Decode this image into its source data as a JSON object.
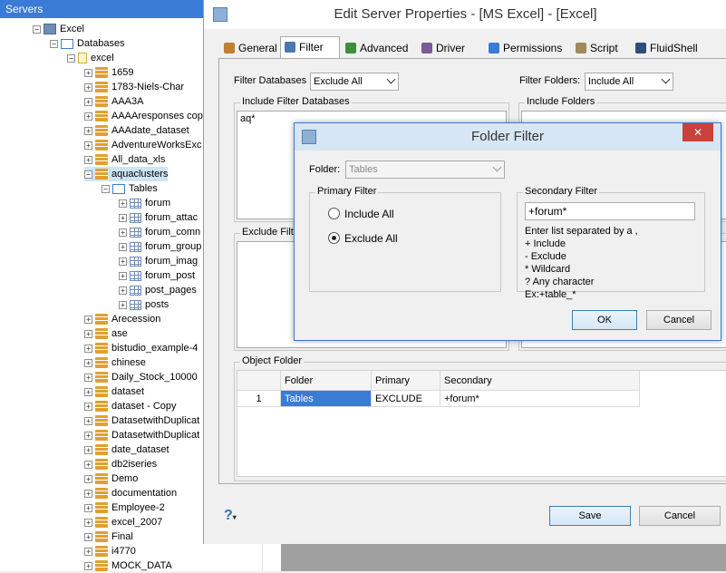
{
  "tree": {
    "header": "Servers",
    "nodes": [
      {
        "label": "Excel",
        "level": 1,
        "icon": "server"
      },
      {
        "label": "Databases",
        "level": 2,
        "icon": "folder"
      },
      {
        "label": "excel",
        "level": 3,
        "icon": "dbfile"
      },
      {
        "label": "1659",
        "level": 4,
        "icon": "db"
      },
      {
        "label": "1783-Niels-Char",
        "level": 4,
        "icon": "db"
      },
      {
        "label": "AAA3A",
        "level": 4,
        "icon": "db"
      },
      {
        "label": "AAAAresponses cop",
        "level": 4,
        "icon": "db"
      },
      {
        "label": "AAAdate_dataset",
        "level": 4,
        "icon": "db"
      },
      {
        "label": "AdventureWorksExc",
        "level": 4,
        "icon": "db"
      },
      {
        "label": "All_data_xls",
        "level": 4,
        "icon": "db"
      },
      {
        "label": "aquaclusters",
        "level": 4,
        "icon": "db",
        "selected": true
      },
      {
        "label": "Tables",
        "level": 5,
        "icon": "folder"
      },
      {
        "label": "forum",
        "level": 6,
        "icon": "table"
      },
      {
        "label": "forum_attac",
        "level": 6,
        "icon": "table"
      },
      {
        "label": "forum_comn",
        "level": 6,
        "icon": "table"
      },
      {
        "label": "forum_group",
        "level": 6,
        "icon": "table"
      },
      {
        "label": "forum_imag",
        "level": 6,
        "icon": "table"
      },
      {
        "label": "forum_post",
        "level": 6,
        "icon": "table"
      },
      {
        "label": "post_pages",
        "level": 6,
        "icon": "table"
      },
      {
        "label": "posts",
        "level": 6,
        "icon": "table"
      },
      {
        "label": "Arecession",
        "level": 4,
        "icon": "db"
      },
      {
        "label": "ase",
        "level": 4,
        "icon": "db"
      },
      {
        "label": "bistudio_example-4",
        "level": 4,
        "icon": "db"
      },
      {
        "label": "chinese",
        "level": 4,
        "icon": "db"
      },
      {
        "label": "Daily_Stock_10000",
        "level": 4,
        "icon": "db"
      },
      {
        "label": "dataset",
        "level": 4,
        "icon": "db"
      },
      {
        "label": "dataset - Copy",
        "level": 4,
        "icon": "db"
      },
      {
        "label": "DatasetwithDuplicat",
        "level": 4,
        "icon": "db"
      },
      {
        "label": "DatasetwithDuplicat",
        "level": 4,
        "icon": "db"
      },
      {
        "label": "date_dataset",
        "level": 4,
        "icon": "db"
      },
      {
        "label": "db2iseries",
        "level": 4,
        "icon": "db"
      },
      {
        "label": "Demo",
        "level": 4,
        "icon": "db"
      },
      {
        "label": "documentation",
        "level": 4,
        "icon": "db"
      },
      {
        "label": "Employee-2",
        "level": 4,
        "icon": "db"
      },
      {
        "label": "excel_2007",
        "level": 4,
        "icon": "db"
      },
      {
        "label": "Final",
        "level": 4,
        "icon": "db"
      },
      {
        "label": "i4770",
        "level": 4,
        "icon": "db"
      },
      {
        "label": "MOCK_DATA",
        "level": 4,
        "icon": "db"
      }
    ]
  },
  "main": {
    "title": "Edit Server Properties - [MS Excel] - [Excel]",
    "tabs": [
      {
        "label": "General",
        "icon": "general-icon"
      },
      {
        "label": "Filter",
        "icon": "filter-icon",
        "active": true
      },
      {
        "label": "Advanced",
        "icon": "advanced-icon"
      },
      {
        "label": "Driver",
        "icon": "driver-icon"
      },
      {
        "label": "Permissions",
        "icon": "permissions-icon"
      },
      {
        "label": "Script",
        "icon": "script-icon"
      },
      {
        "label": "FluidShell",
        "icon": "fluidshell-icon"
      }
    ],
    "filter_databases_label": "Filter Databases",
    "filter_databases_value": "Exclude All",
    "filter_folders_label": "Filter Folders:",
    "filter_folders_value": "Include All",
    "include_filter_db_title": "Include Filter Databases",
    "include_filter_db_text": "aq*",
    "include_folders_title": "Include Folders",
    "exclude_filter_title": "Exclude Filte",
    "object_folder_title": "Object Folder",
    "grid": {
      "headers": [
        "Folder",
        "Primary",
        "Secondary"
      ],
      "rows": [
        {
          "num": "1",
          "folder": "Tables",
          "primary": "EXCLUDE",
          "secondary": "+forum*"
        }
      ]
    },
    "help_label": "?",
    "save_label": "Save",
    "cancel_label": "Cancel"
  },
  "folder_filter": {
    "title": "Folder Filter",
    "close_label": "✕",
    "folder_label": "Folder:",
    "folder_value": "Tables",
    "primary_title": "Primary Filter",
    "include_all_label": "Include All",
    "exclude_all_label": "Exclude All",
    "primary_selected": "Exclude All",
    "secondary_title": "Secondary Filter",
    "secondary_value": "+forum*",
    "help_lines": [
      "Enter list separated by a ,",
      "+ Include",
      "- Exclude",
      "* Wildcard",
      "? Any character",
      "Ex:+table_*"
    ],
    "ok_label": "OK",
    "cancel_label": "Cancel"
  }
}
